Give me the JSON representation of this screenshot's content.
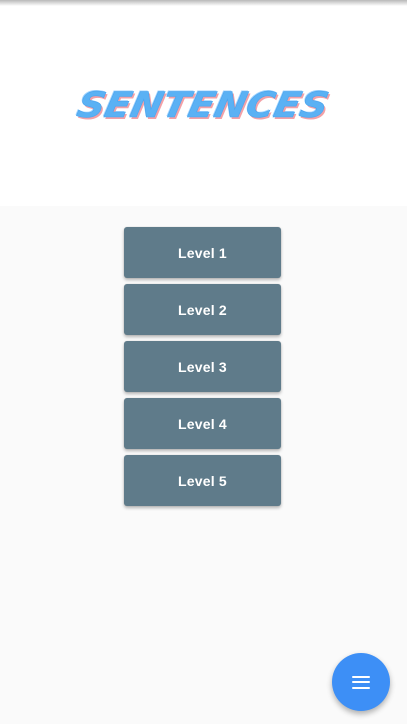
{
  "header": {
    "title": "SENTENCES"
  },
  "levels": [
    {
      "label": "Level 1"
    },
    {
      "label": "Level 2"
    },
    {
      "label": "Level 3"
    },
    {
      "label": "Level 4"
    },
    {
      "label": "Level 5"
    }
  ],
  "fab": {
    "icon": "menu-icon"
  },
  "colors": {
    "title": "#5ab1f4",
    "title_shadow": "#f3a1a7",
    "button_bg": "#5f7b8a",
    "fab_bg": "#3d8ff6",
    "background": "#fafafa"
  }
}
